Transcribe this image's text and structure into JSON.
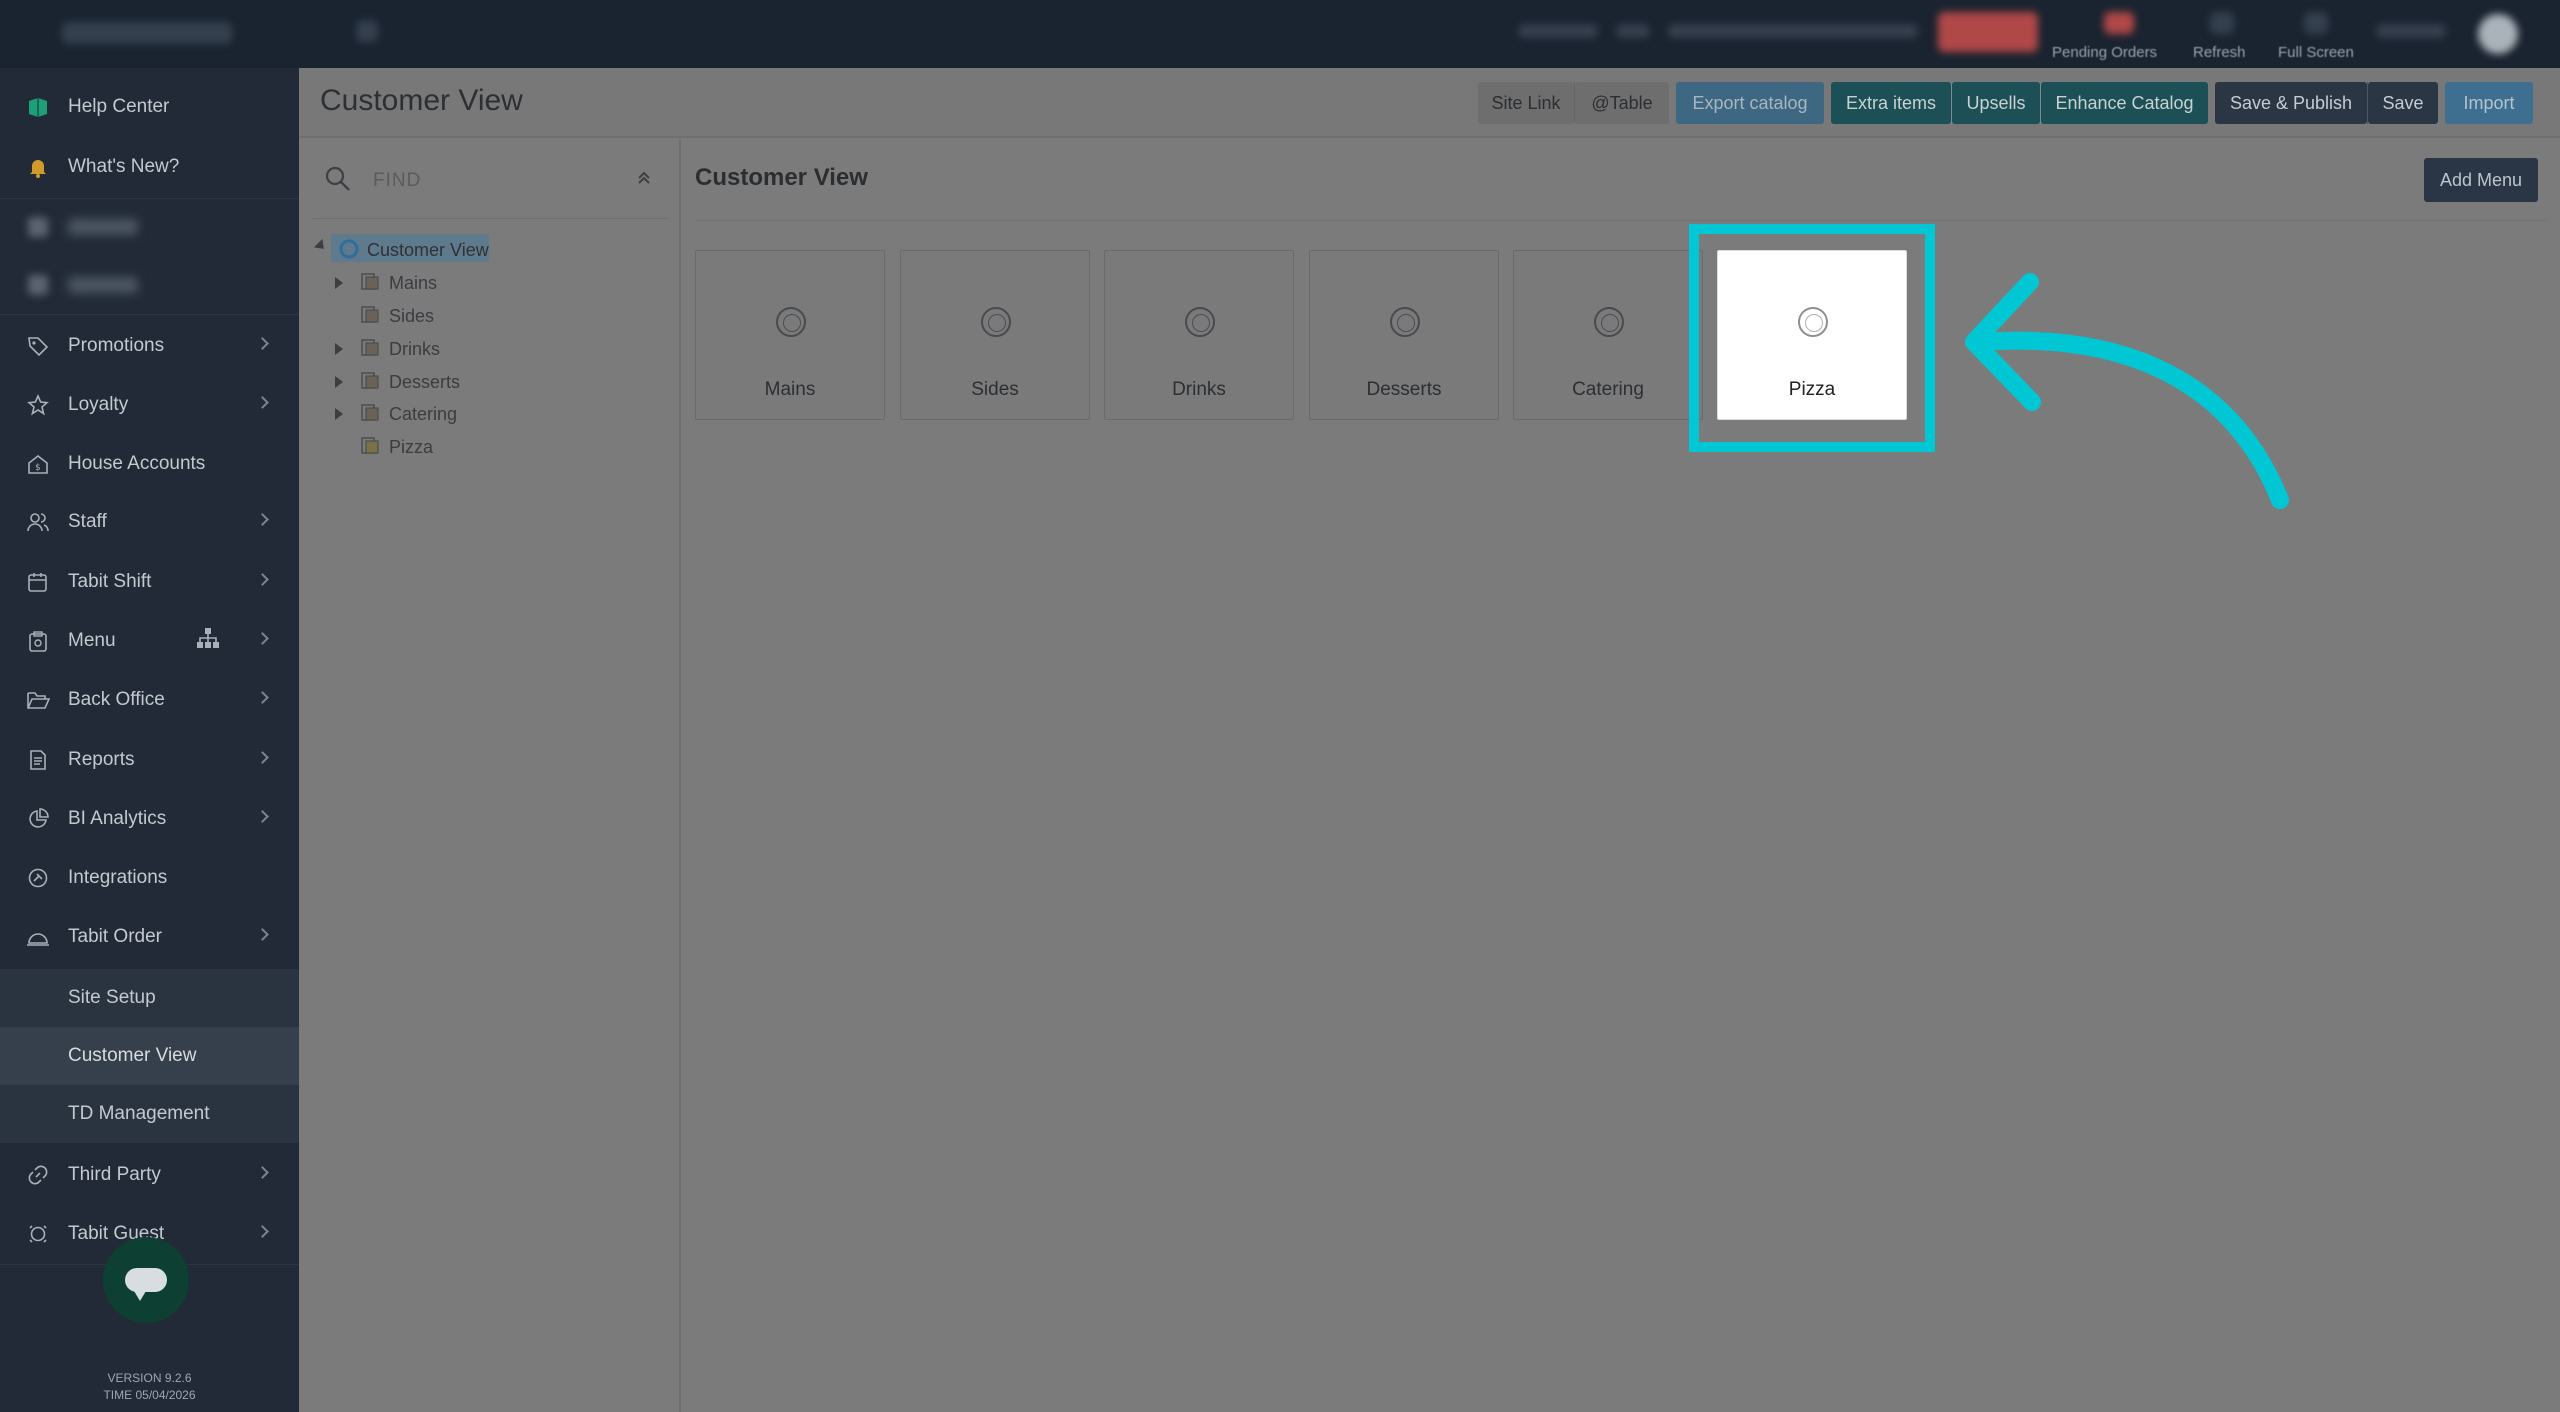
{
  "header": {
    "captions": [
      "Pending Orders",
      "Refresh",
      "Full Screen"
    ]
  },
  "sidebar": {
    "items": [
      {
        "label": "Help Center",
        "icon": "help-center-icon"
      },
      {
        "label": "What's New?",
        "icon": "bell-icon"
      },
      {
        "label": "",
        "icon": "blurred-icon"
      },
      {
        "label": "",
        "icon": "blurred-icon"
      },
      {
        "label": "Promotions",
        "icon": "tag-icon"
      },
      {
        "label": "Loyalty",
        "icon": "star-icon"
      },
      {
        "label": "House Accounts",
        "icon": "house-dollar-icon"
      },
      {
        "label": "Staff",
        "icon": "users-icon"
      },
      {
        "label": "Tabit Shift",
        "icon": "calendar-icon"
      },
      {
        "label": "Menu",
        "icon": "menu-clipboard-icon"
      },
      {
        "label": "Back Office",
        "icon": "folder-open-icon"
      },
      {
        "label": "Reports",
        "icon": "document-icon"
      },
      {
        "label": "BI Analytics",
        "icon": "pie-chart-icon"
      },
      {
        "label": "Integrations",
        "icon": "integrations-icon"
      },
      {
        "label": "Tabit Order",
        "icon": "cloche-icon"
      },
      {
        "label": "Site Setup"
      },
      {
        "label": "Customer View"
      },
      {
        "label": "TD Management"
      },
      {
        "label": "Third Party",
        "icon": "link-icon"
      },
      {
        "label": "Tabit Guest",
        "icon": "guest-icon"
      }
    ],
    "version": "VERSION 9.2.6",
    "time": "TIME 05/04/2026"
  },
  "main": {
    "title": "Customer View",
    "toolbar": {
      "site_link": "Site Link",
      "at_table": "@Table",
      "export_catalog": "Export catalog",
      "extra_items": "Extra items",
      "upsells": "Upsells",
      "enhance_catalog": "Enhance Catalog",
      "save_publish": "Save & Publish",
      "save": "Save",
      "import": "Import"
    }
  },
  "tree": {
    "find_placeholder": "FIND",
    "root": "Customer View",
    "children": [
      "Mains",
      "Sides",
      "Drinks",
      "Desserts",
      "Catering",
      "Pizza"
    ]
  },
  "content": {
    "title": "Customer View",
    "add_menu": "Add Menu",
    "cards": [
      "Mains",
      "Sides",
      "Drinks",
      "Desserts",
      "Catering",
      "Pizza"
    ]
  },
  "colors": {
    "highlight": "#00c7d3",
    "sidebar": "#212a36",
    "topbar": "#1a2330"
  }
}
